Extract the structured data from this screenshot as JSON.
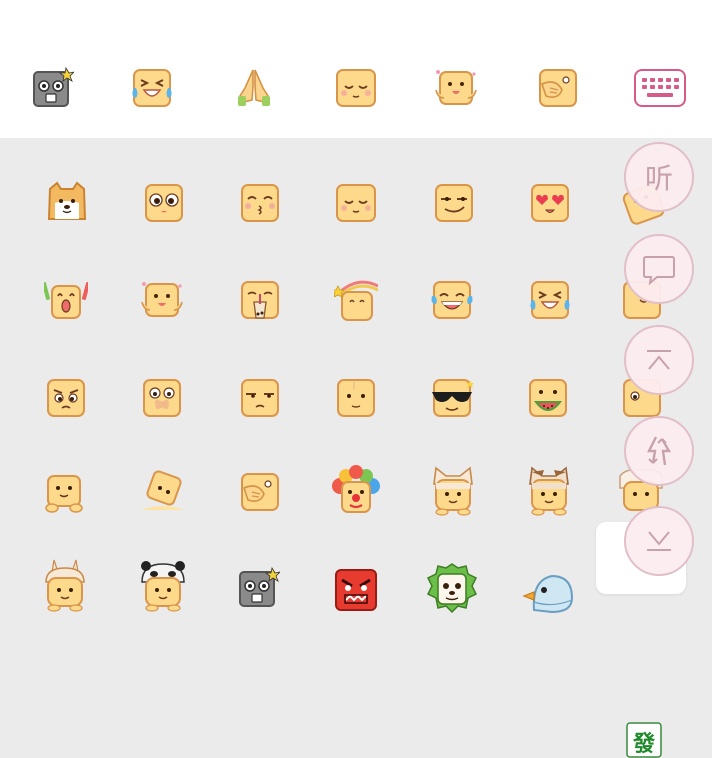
{
  "recent_bar": {
    "items": [
      {
        "icon": "robot-gray-icon"
      },
      {
        "icon": "crying-laughing-face-icon"
      },
      {
        "icon": "praying-hands-icon"
      },
      {
        "icon": "blissful-face-icon"
      },
      {
        "icon": "happy-waving-face-icon"
      },
      {
        "icon": "facepalm-face-icon"
      }
    ],
    "keyboard_toggle": {
      "icon": "keyboard-icon"
    }
  },
  "emoji_grid": {
    "rows": [
      [
        "dog-face-icon",
        "shy-cry-face-icon",
        "kissing-face-icon",
        "blissful-face-icon",
        "smirk-face-icon",
        "heart-eyes-face-icon",
        "peek-face-icon"
      ],
      [
        "cheering-face-icon",
        "happy-waving-face-icon",
        "bubble-tea-face-icon",
        "rainbow-star-face-icon",
        "laughing-tears-face-icon",
        "crying-laughing-face-icon",
        "shy-face-icon"
      ],
      [
        "angry-frown-face-icon",
        "taped-mouth-face-icon",
        "unamused-face-icon",
        "nervous-face-icon",
        "sunglasses-face-icon",
        "watermelon-face-icon",
        "worried-face-icon"
      ],
      [
        "sitting-smile-face-icon",
        "melting-face-icon",
        "facepalm-face-icon",
        "clown-face-icon",
        "cat-hat-face-icon",
        "brown-cat-hat-face-icon",
        "puppy-hat-face-icon"
      ],
      [
        "bunny-hat-face-icon",
        "panda-hat-face-icon",
        "robot-gray-icon",
        "angry-red-face-icon",
        "green-lion-face-icon",
        "blue-bird-icon",
        "fa-tile-icon"
      ]
    ],
    "fa_tile_text": "發"
  },
  "side_buttons": {
    "listen_label": "听",
    "items": [
      {
        "icon": "listen-button"
      },
      {
        "icon": "speech-bubble-icon"
      },
      {
        "icon": "scroll-to-top-icon"
      },
      {
        "icon": "refresh-arrows-icon"
      },
      {
        "icon": "scroll-to-bottom-icon"
      }
    ]
  }
}
